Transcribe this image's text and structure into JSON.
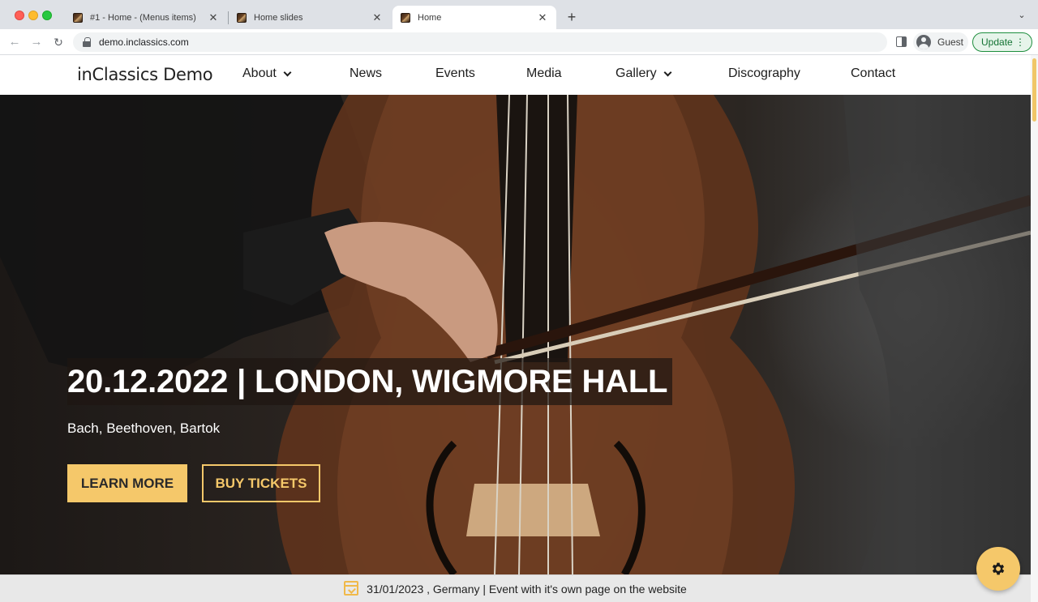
{
  "browser": {
    "tabs": [
      {
        "title": "#1 - Home - (Menus items)",
        "active": false
      },
      {
        "title": "Home slides",
        "active": false
      },
      {
        "title": "Home",
        "active": true
      }
    ],
    "url": "demo.inclassics.com",
    "profile_label": "Guest",
    "update_label": "Update"
  },
  "site": {
    "logo": "inClassics Demo",
    "nav": [
      {
        "label": "About",
        "has_dropdown": true
      },
      {
        "label": "News",
        "has_dropdown": false
      },
      {
        "label": "Events",
        "has_dropdown": false
      },
      {
        "label": "Media",
        "has_dropdown": false
      },
      {
        "label": "Gallery",
        "has_dropdown": true
      },
      {
        "label": "Discography",
        "has_dropdown": false
      },
      {
        "label": "Contact",
        "has_dropdown": false
      }
    ],
    "hero": {
      "title": "20.12.2022 | LONDON, WIGMORE HALL",
      "subtitle": "Bach, Beethoven, Bartok",
      "learn_more_label": "LEARN MORE",
      "buy_tickets_label": "BUY TICKETS"
    },
    "event_bar": {
      "text": "31/01/2023 , Germany | Event with it's own page on the website",
      "icon": "calendar-check-icon"
    },
    "settings_icon": "gear-icon",
    "accent_color": "#f5c86a"
  }
}
